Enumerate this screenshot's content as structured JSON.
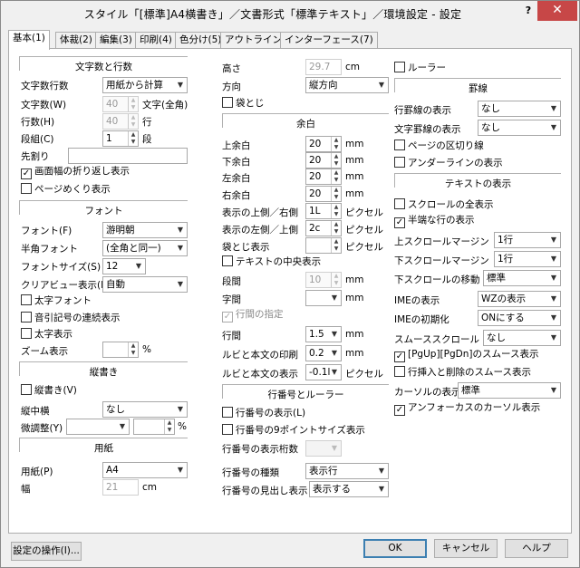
{
  "window": {
    "title": "スタイル「[標準]A4横書き」／文書形式「標準テキスト」／環境設定 - 設定",
    "help": "?",
    "close": "✕"
  },
  "tabs": [
    "基本(1)",
    "体裁(2)",
    "編集(3)",
    "印刷(4)",
    "色分け(5)",
    "アウトライン(6)",
    "インターフェース(7)"
  ],
  "col1": {
    "sec_moji": "文字数と行数",
    "moji_gyosu_label": "文字数行数",
    "moji_gyosu_value": "用紙から計算",
    "mojisu_label": "文字数(W)",
    "mojisu_value": "40",
    "mojisu_unit": "文字(全角)",
    "gyosu_label": "行数(H)",
    "gyosu_value": "40",
    "gyosu_unit": "行",
    "dangumi_label": "段組(C)",
    "dangumi_value": "1",
    "dangumi_unit": "段",
    "sakiwari_label": "先割り",
    "cb_gamen": "画面幅の折り返し表示",
    "cb_page": "ページめくり表示",
    "sec_font": "フォント",
    "font_label": "フォント(F)",
    "font_value": "游明朝",
    "hankaku_label": "半角フォント",
    "hankaku_value": "(全角と同一)",
    "fontsize_label": "フォントサイズ(S)",
    "fontsize_value": "12",
    "cleartype_label": "クリアビュー表示(D)",
    "cleartype_value": "自動",
    "cb_bold": "太字フォント",
    "cb_onbiki": "音引記号の連続表示",
    "cb_boldview": "太字表示",
    "zoom_label": "ズーム表示",
    "zoom_unit": "%",
    "sec_tate": "縦書き",
    "cb_tate": "縦書き(V)",
    "tatechu_label": "縦中横",
    "tatechu_value": "なし",
    "bichosei_label": "微調整(Y)",
    "bichosei_unit": "%",
    "sec_yoshi": "用紙",
    "yoshi_label": "用紙(P)",
    "yoshi_value": "A4",
    "haba_label": "幅",
    "haba_value": "21",
    "haba_unit": "cm"
  },
  "col2": {
    "takasa_label": "高さ",
    "takasa_value": "29.7",
    "takasa_unit": "cm",
    "hoko_label": "方向",
    "hoko_value": "縦方向",
    "cb_fukuro": "袋とじ",
    "sec_yohaku": "余白",
    "ue_label": "上余白",
    "ue_value": "20",
    "ue_unit": "mm",
    "shita_label": "下余白",
    "shita_value": "20",
    "shita_unit": "mm",
    "hidari_label": "左余白",
    "hidari_value": "20",
    "hidari_unit": "mm",
    "migi_label": "右余白",
    "migi_value": "20",
    "migi_unit": "mm",
    "ue_migi_label": "表示の上側／右側",
    "ue_migi_value": "1L",
    "ue_migi_unit": "ピクセル",
    "hidari_shita_label": "表示の左側／上側",
    "hidari_shita_value": "2c",
    "hidari_shita_unit": "ピクセル",
    "fukuro_disp_label": "袋とじ表示",
    "fukuro_disp_unit": "ピクセル",
    "cb_center": "テキストの中央表示",
    "dankan_label": "段間",
    "dankan_value": "10",
    "dankan_unit": "mm",
    "jikan_label": "字間",
    "jikan_unit": "mm",
    "cb_gyokan": "行間の指定",
    "gyokan_label": "行間",
    "gyokan_value": "1.5",
    "gyokan_unit": "mm",
    "ruby_print_label": "ルビと本文の印刷",
    "ruby_print_value": "0.2",
    "ruby_print_unit": "mm",
    "ruby_disp_label": "ルビと本文の表示",
    "ruby_disp_value": "-0.1l",
    "ruby_disp_unit": "ピクセル",
    "sec_gyoban": "行番号とルーラー",
    "cb_gyoban": "行番号の表示(L)",
    "cb_gyoban9": "行番号の9ポイントサイズ表示",
    "keta_label": "行番号の表示桁数",
    "shurui_label": "行番号の種類",
    "shurui_value": "表示行",
    "midashi_label": "行番号の見出し表示",
    "midashi_value": "表示する"
  },
  "col3": {
    "cb_ruler": "ルーラー",
    "sec_keisen": "罫線",
    "gyokei_label": "行罫線の表示",
    "gyokei_value": "なし",
    "mojikei_label": "文字罫線の表示",
    "mojikei_value": "なし",
    "cb_pagekugiri": "ページの区切り線",
    "cb_underline": "アンダーラインの表示",
    "sec_textdisp": "テキストの表示",
    "cb_scrollall": "スクロールの全表示",
    "cb_hanpa": "半端な行の表示",
    "upmargin_label": "上スクロールマージン",
    "upmargin_value": "1行",
    "downmargin_label": "下スクロールマージン",
    "downmargin_value": "1行",
    "downmove_label": "下スクロールの移動",
    "downmove_value": "標準",
    "ime_label": "IMEの表示",
    "ime_value": "WZの表示",
    "imeinit_label": "IMEの初期化",
    "imeinit_value": "ONにする",
    "smooth_label": "スムーススクロール",
    "smooth_value": "なし",
    "cb_pgupdn": "[PgUp][PgDn]のスムース表示",
    "cb_insdel": "行挿入と削除のスムース表示",
    "cursor_label": "カーソルの表示",
    "cursor_value": "標準",
    "cb_antifocus": "アンフォーカスのカーソル表示"
  },
  "footer": {
    "settings_ops": "設定の操作(I)...",
    "ok": "OK",
    "cancel": "キャンセル",
    "help": "ヘルプ"
  },
  "icons": {
    "dropdown": "▼",
    "spin_up": "▲",
    "spin_down": "▼",
    "check": "✓"
  }
}
